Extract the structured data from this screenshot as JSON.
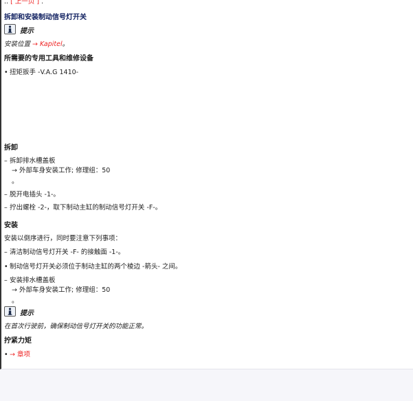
{
  "nav": {
    "prev_link": "[ 上一页 ]",
    "prev_dots": "..",
    "prev_trail": " ."
  },
  "doc_title": "拆卸和安装制动信号灯开关",
  "hint1": {
    "icon": "info-icon",
    "label": "提示",
    "text_prefix": "安装位置",
    "link": "→ Kapitel",
    "text_suffix": "。"
  },
  "tools": {
    "heading": "所需要的专用工具和维修设备",
    "items": [
      "扭矩扳手 -V.A.G 1410-"
    ]
  },
  "removal": {
    "heading": "拆卸",
    "steps": [
      {
        "marker": "–",
        "text": "拆卸排水槽盖板",
        "link": "→ 外部车身安装工作; 修理组：50",
        "tail": "。"
      },
      {
        "marker": "–",
        "text": "脱开电插头 -1-。"
      },
      {
        "marker": "–",
        "text": "拧出螺栓 -2-，取下制动主缸的制动信号灯开关 -F-。"
      }
    ]
  },
  "install": {
    "heading": "安装",
    "intro": "安装以倒序进行，同时要注意下列事项：",
    "steps": [
      {
        "marker": "–",
        "text": "清洁制动信号灯开关 -F- 的接触面 -1-。"
      },
      {
        "marker": "•",
        "text": "制动信号灯开关必须位于制动主缸的两个棱边 -箭头- 之间。"
      },
      {
        "marker": "–",
        "text": "安装排水槽盖板",
        "link": "→ 外部车身安装工作; 修理组：50",
        "tail": "。"
      }
    ]
  },
  "hint2": {
    "icon": "info-icon",
    "label": "提示",
    "text": "在首次行驶前，确保制动信号灯开关的功能正常。"
  },
  "torque": {
    "heading": "拧紧力矩",
    "items": [
      {
        "marker": "•",
        "link": "→ 章项"
      }
    ]
  },
  "colors": {
    "link_red": "#ee2222",
    "link_green": "#2e8b2e",
    "title_navy": "#102060"
  }
}
